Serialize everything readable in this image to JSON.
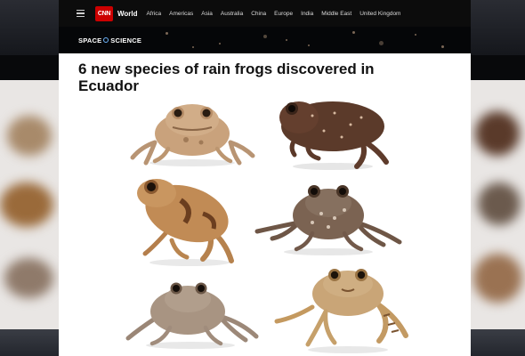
{
  "nav": {
    "logo_text": "CNN",
    "edition_label": "World",
    "menu_icon": "hamburger-icon",
    "items": [
      "Africa",
      "Americas",
      "Asia",
      "Australia",
      "China",
      "Europe",
      "India",
      "Middle East",
      "United Kingdom"
    ]
  },
  "section": {
    "title_left": "SPACE",
    "title_right": "SCIENCE",
    "separator_icon": "globe-icon"
  },
  "article": {
    "headline": "6 new species of rain frogs discovered in Ecuador"
  },
  "colors": {
    "brand_red": "#cc0000",
    "nav_bg": "#0c0c0c",
    "headline_text": "#121212"
  }
}
